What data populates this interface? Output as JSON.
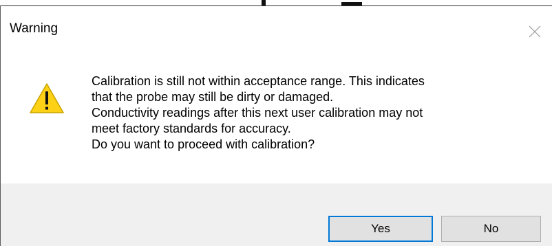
{
  "dialog": {
    "title": "Warning",
    "icon": "warning-triangle-icon",
    "message_lines": [
      "Calibration is still not within acceptance range. This indicates",
      "that the probe may still be dirty or damaged.",
      "Conductivity readings after this next user calibration may not",
      "meet factory standards for accuracy.",
      "Do you want to proceed with calibration?"
    ],
    "buttons": {
      "yes_label": "Yes",
      "no_label": "No"
    },
    "colors": {
      "footer_background": "#f0f0f0",
      "default_button_border": "#0078d7",
      "warning_fill": "#fcd116"
    }
  }
}
